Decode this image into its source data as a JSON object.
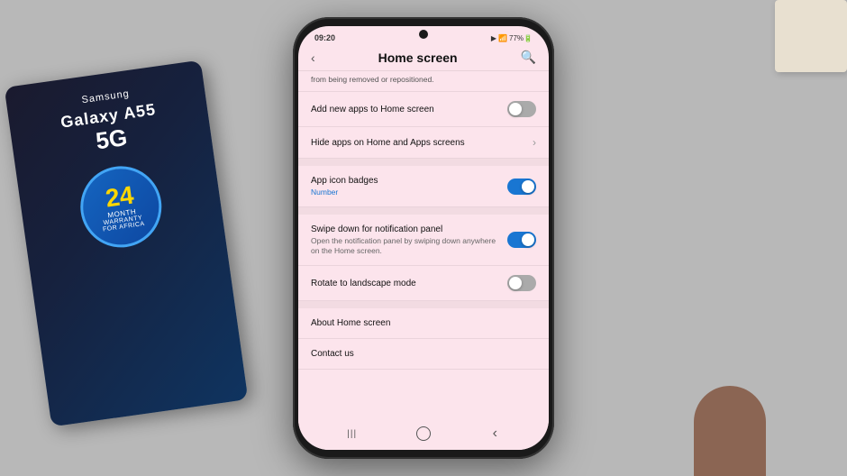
{
  "background_color": "#b8b8b8",
  "status_bar": {
    "time": "09:20",
    "icons": "▶ 📶 🔋 77%"
  },
  "top_nav": {
    "back_label": "‹",
    "title": "Home screen",
    "search_icon": "🔍"
  },
  "settings": {
    "divider_note": "from being removed or repositioned.",
    "rows": [
      {
        "id": "add-apps",
        "title": "Add new apps to Home screen",
        "subtitle": "",
        "toggle": "off"
      },
      {
        "id": "hide-apps",
        "title": "Hide apps on Home and Apps screens",
        "subtitle": "",
        "toggle": null
      },
      {
        "id": "app-icon-badges",
        "title": "App icon badges",
        "subtitle": "Number",
        "subtitle_color": "blue",
        "toggle": "on"
      },
      {
        "id": "swipe-down",
        "title": "Swipe down for notification panel",
        "subtitle": "Open the notification panel by swiping down anywhere on the Home screen.",
        "subtitle_color": "normal",
        "toggle": "on"
      },
      {
        "id": "rotate",
        "title": "Rotate to landscape mode",
        "subtitle": "",
        "toggle": "off"
      }
    ],
    "plain_rows": [
      {
        "id": "about-home-screen",
        "label": "About Home screen"
      },
      {
        "id": "contact-us",
        "label": "Contact us"
      }
    ]
  },
  "bottom_nav": {
    "recent_label": "|||",
    "home_label": "○",
    "back_label": "‹"
  },
  "samsung_box": {
    "brand": "Samsung",
    "model": "Galaxy A55",
    "variant": "5G",
    "warranty_number": "24",
    "warranty_month": "MONTH",
    "warranty_text": "WARRANTY\nFOR AFRICA"
  }
}
